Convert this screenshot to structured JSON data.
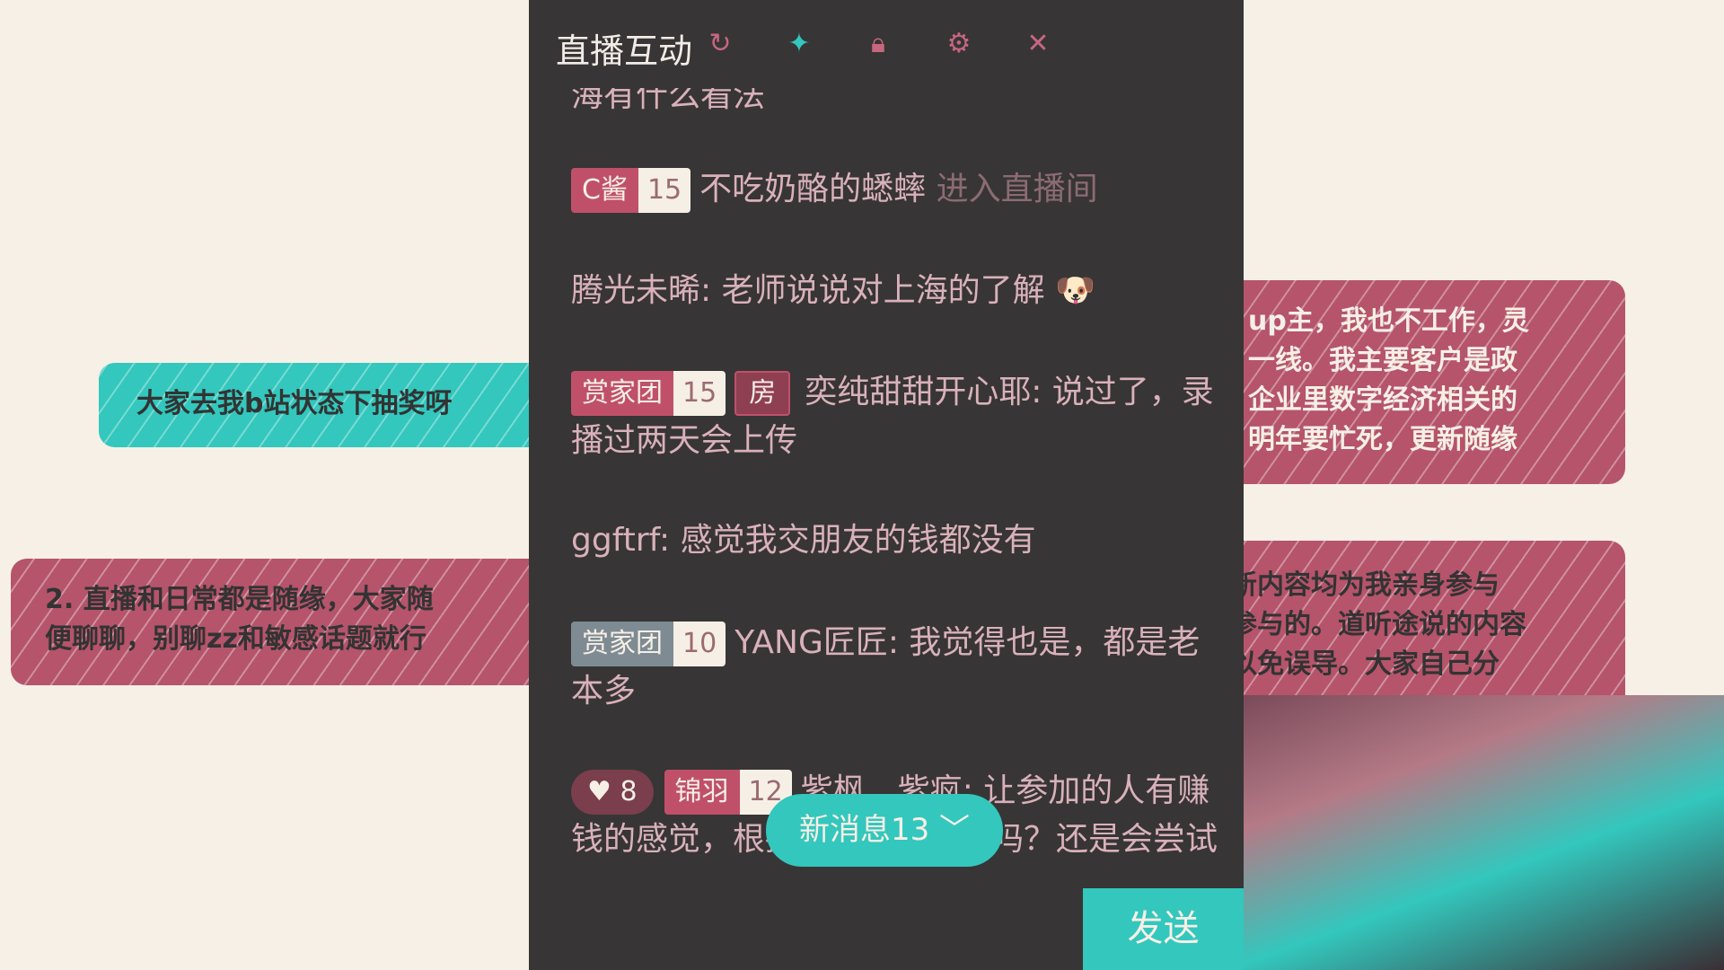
{
  "panel": {
    "title": "直播互动",
    "icons": [
      "refresh-icon",
      "pin-icon",
      "lock-icon",
      "gear-icon",
      "close-icon"
    ],
    "close": "✕"
  },
  "messages": [
    {
      "text": "海有什么看法"
    },
    {
      "badge": "C酱",
      "level": "15",
      "user": "不吃奶酪的蟋蟀",
      "action": "进入直播间"
    },
    {
      "text": "腾光未晞: 老师说说对上海的了解 🐶"
    },
    {
      "badge": "赏家团",
      "level": "15",
      "tag": "房",
      "text": "奕纯甜甜开心耶: 说过了，录播过两天会上传"
    },
    {
      "text": "ggftrf: 感觉我交朋友的钱都没有"
    },
    {
      "badge": "赏家团",
      "level": "10",
      "text": "YANG匠匠: 我觉得也是，都是老本多"
    },
    {
      "heart_level": "8",
      "badge": "锦羽",
      "level": "12",
      "text": "紫枫__紫疯: 让参加的人有赚钱的感觉，根据行业去做细分吗？还是会尝试"
    }
  ],
  "new_messages": "新消息13 ﹀",
  "send": "发送",
  "cards": {
    "left1": "大家去我b站状态下抽奖呀",
    "left2": [
      "2. 直播和日常都是随缘，大家随",
      "便聊聊，别聊zz和敏感话题就行"
    ],
    "right1": [
      "up主，我也不工作，灵",
      "一线。我主要客户是政",
      "企业里数字经济相关的",
      "明年要忙死，更新随缘"
    ],
    "right2": [
      "新内容均为我亲身参与",
      "参与的。道听途说的内容",
      "以免误导。大家自己分"
    ]
  },
  "colors": {
    "accent": "#33c7bd",
    "pink": "#b5546b",
    "panel": "#373535"
  }
}
